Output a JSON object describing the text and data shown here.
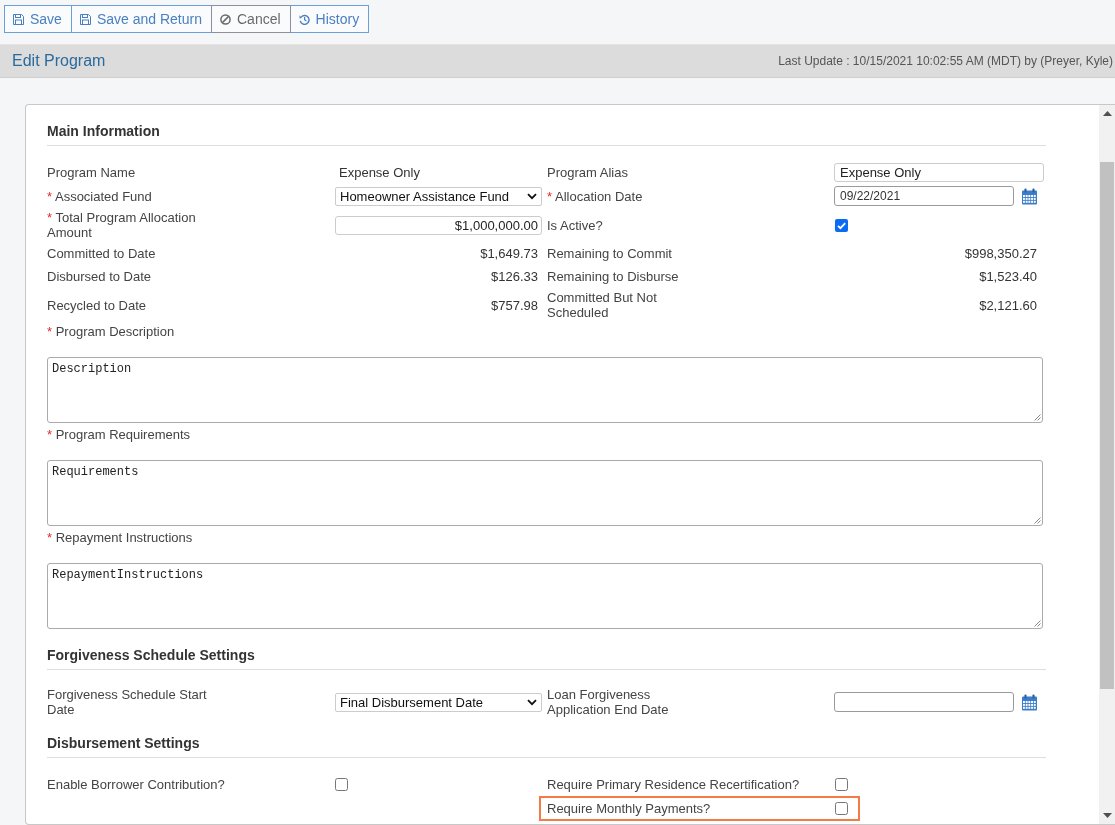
{
  "toolbar": {
    "buttons": [
      {
        "kind": "save",
        "label": "Save"
      },
      {
        "kind": "save",
        "label": "Save and Return"
      },
      {
        "kind": "cancel",
        "label": "Cancel"
      },
      {
        "kind": "history",
        "label": "History"
      }
    ]
  },
  "header": {
    "title": "Edit Program",
    "last_update": "Last Update : 10/15/2021 10:02:55 AM (MDT) by (Preyer, Kyle)"
  },
  "sections": [
    {
      "title": "Main Information",
      "rows": [
        {
          "left": {
            "kind": "text",
            "label": "Program Name",
            "value": "Expense Only"
          },
          "right": {
            "kind": "input",
            "label": "Program Alias",
            "value": "Expense Only"
          }
        },
        {
          "left": {
            "kind": "select",
            "required_mark": "*",
            "label": "Associated Fund",
            "value": "Homeowner Assistance Fund"
          },
          "right": {
            "kind": "date",
            "required_mark": "*",
            "label": "Allocation Date",
            "value": "09/22/2021"
          }
        },
        {
          "left": {
            "kind": "amount_input",
            "required_mark": "*",
            "label": "Total Program Allocation Amount",
            "value": "$1,000,000.00"
          },
          "right": {
            "kind": "checkbox",
            "label": "Is Active?",
            "checked": true
          }
        },
        {
          "left": {
            "kind": "amount",
            "label": "Committed to Date",
            "value": "$1,649.73"
          },
          "right": {
            "kind": "amount",
            "label": "Remaining to Commit",
            "value": "$998,350.27"
          }
        },
        {
          "left": {
            "kind": "amount",
            "label": "Disbursed to Date",
            "value": "$126.33"
          },
          "right": {
            "kind": "amount",
            "label": "Remaining to Disburse",
            "value": "$1,523.40"
          }
        },
        {
          "left": {
            "kind": "amount",
            "label": "Recycled to Date",
            "value": "$757.98"
          },
          "right": {
            "kind": "amount",
            "label": "Committed But Not Scheduled",
            "value": "$2,121.60"
          }
        },
        {
          "full": {
            "kind": "textarea",
            "required_mark": "*",
            "label": "Program Description",
            "value": "Description"
          }
        },
        {
          "full": {
            "kind": "textarea",
            "required_mark": "*",
            "label": "Program Requirements",
            "value": "Requirements"
          }
        },
        {
          "full": {
            "kind": "textarea",
            "required_mark": "*",
            "label": "Repayment Instructions",
            "value": "RepaymentInstructions"
          }
        }
      ]
    },
    {
      "title": "Forgiveness Schedule Settings",
      "rows": [
        {
          "left": {
            "kind": "select",
            "label": "Forgiveness Schedule Start Date",
            "value": "Final Disbursement Date"
          },
          "right": {
            "kind": "date",
            "label": "Loan Forgiveness Application End Date"
          }
        }
      ]
    },
    {
      "title": "Disbursement Settings",
      "rows": [
        {
          "left": {
            "kind": "checkbox",
            "label": "Enable Borrower Contribution?",
            "checked": false,
            "highlighted": false
          },
          "right": {
            "kind": "checkbox",
            "label": "Require Primary Residence Recertification?",
            "checked": false,
            "highlighted": false
          }
        },
        {
          "right": {
            "kind": "checkbox",
            "label": "Require Monthly Payments?",
            "checked": false,
            "highlighted": true
          }
        }
      ]
    }
  ]
}
